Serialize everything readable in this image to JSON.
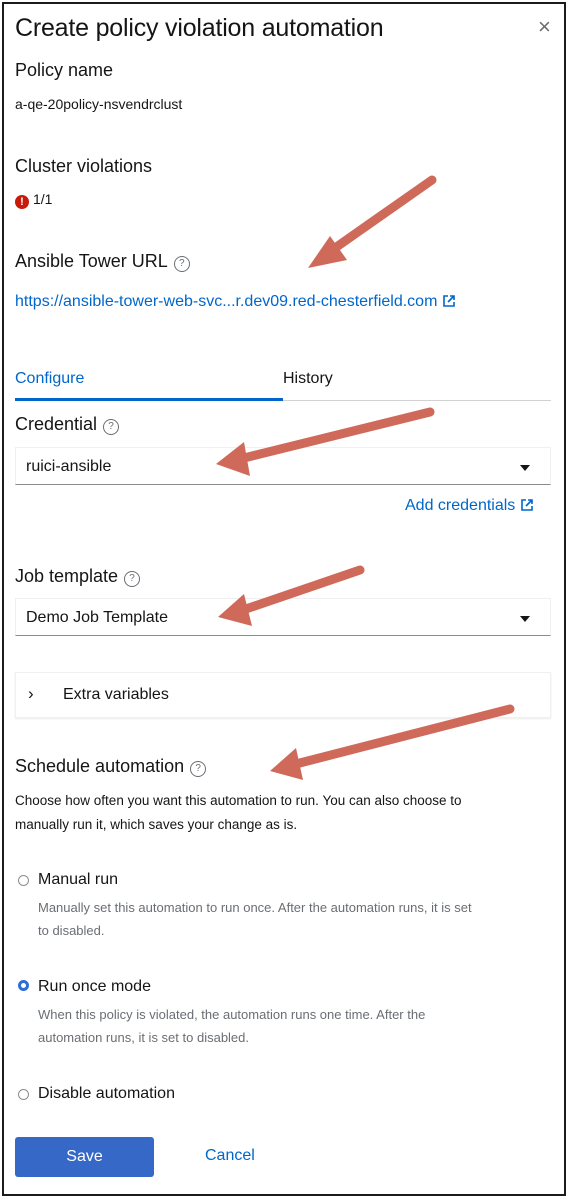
{
  "modal": {
    "title": "Create policy violation automation",
    "close_icon": "×"
  },
  "policy": {
    "label": "Policy name",
    "value": "a-qe-20policy-nsvendrclust"
  },
  "violations": {
    "label": "Cluster violations",
    "value": "1/1",
    "icon": "!"
  },
  "tower": {
    "label": "Ansible Tower URL",
    "url": "https://ansible-tower-web-svc...r.dev09.red-chesterfield.com"
  },
  "tabs": {
    "configure": "Configure",
    "history": "History"
  },
  "credential": {
    "label": "Credential",
    "selected": "ruici-ansible",
    "add_link": "Add credentials"
  },
  "job_template": {
    "label": "Job template",
    "selected": "Demo Job Template"
  },
  "extra_vars": {
    "label": "Extra variables",
    "chevron": "›"
  },
  "schedule": {
    "label": "Schedule automation",
    "description_line1": "Choose how often you want this automation to run. You can also choose to",
    "description_line2": "manually run it, which saves your change as is.",
    "options": [
      {
        "label": "Manual run",
        "desc1": "Manually set this automation to run once. After the automation runs, it is set",
        "desc2": "to disabled.",
        "checked": false
      },
      {
        "label": "Run once mode",
        "desc1": "When this policy is violated, the automation runs one time. After the",
        "desc2": "automation runs, it is set to disabled.",
        "checked": true
      },
      {
        "label": "Disable automation",
        "checked": false
      }
    ]
  },
  "help_glyph": "?",
  "actions": {
    "save": "Save",
    "cancel": "Cancel"
  },
  "colors": {
    "primary": "#3668c7",
    "link": "#0066cc",
    "annotation_arrow": "#cf6a5a",
    "error": "#c9190b"
  }
}
